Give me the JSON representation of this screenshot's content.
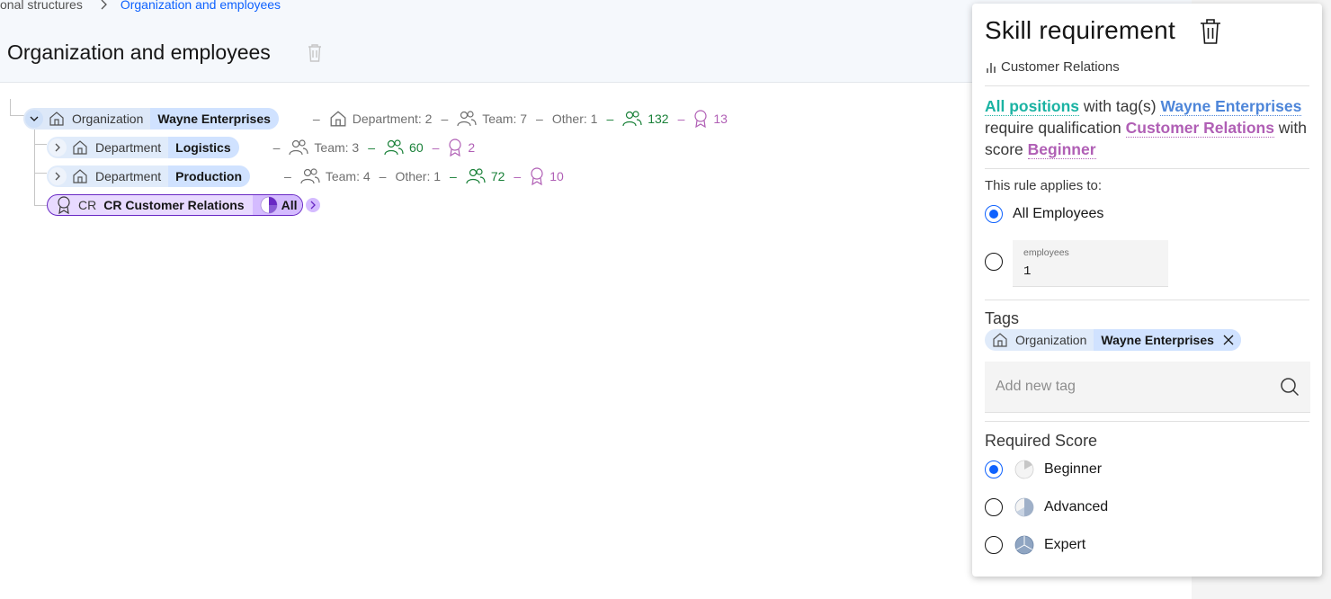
{
  "breadcrumb": {
    "parent": "onal structures",
    "current": "Organization and employees"
  },
  "page": {
    "title": "Organization and employees"
  },
  "tree": {
    "root": {
      "type": "Organization",
      "name": "Wayne Enterprises",
      "stats": {
        "departments": "Department: 2",
        "teams": "Team: 7",
        "other": "Other: 1",
        "employees": "132",
        "skills": "13"
      }
    },
    "children": [
      {
        "type": "Department",
        "name": "Logistics",
        "stats": {
          "teams": "Team: 3",
          "employees": "60",
          "skills": "2"
        }
      },
      {
        "type": "Department",
        "name": "Production",
        "stats": {
          "teams": "Team: 4",
          "other": "Other: 1",
          "employees": "72",
          "skills": "10"
        }
      }
    ],
    "skill": {
      "abbr": "CR",
      "name": "CR Customer Relations",
      "level": "All"
    }
  },
  "panel": {
    "title": "Skill requirement",
    "subtitle": "Customer Relations",
    "rule": {
      "positions": "All positions",
      "with_tags": " with tag(s) ",
      "tag": "Wayne Enterprises",
      "require": " require qualification ",
      "qualification": "Customer Relations",
      "with_score": " with score ",
      "score": "Beginner"
    },
    "applies_label": "This rule applies to:",
    "applies_options": {
      "all": "All Employees",
      "count_label": "employees",
      "count_value": "1"
    },
    "tags_label": "Tags",
    "tag": {
      "type": "Organization",
      "name": "Wayne Enterprises"
    },
    "add_tag_placeholder": "Add new tag",
    "score_label": "Required Score",
    "scores": [
      "Beginner",
      "Advanced",
      "Expert"
    ]
  },
  "colors": {
    "accent": "#0f62fe",
    "org_pill": "#e0ebfa",
    "org_name": "#d0e2ff",
    "skill_pill": "#e8daff",
    "green": "#198038",
    "purple": "#b05fb5",
    "teal": "#1bb3a3"
  }
}
